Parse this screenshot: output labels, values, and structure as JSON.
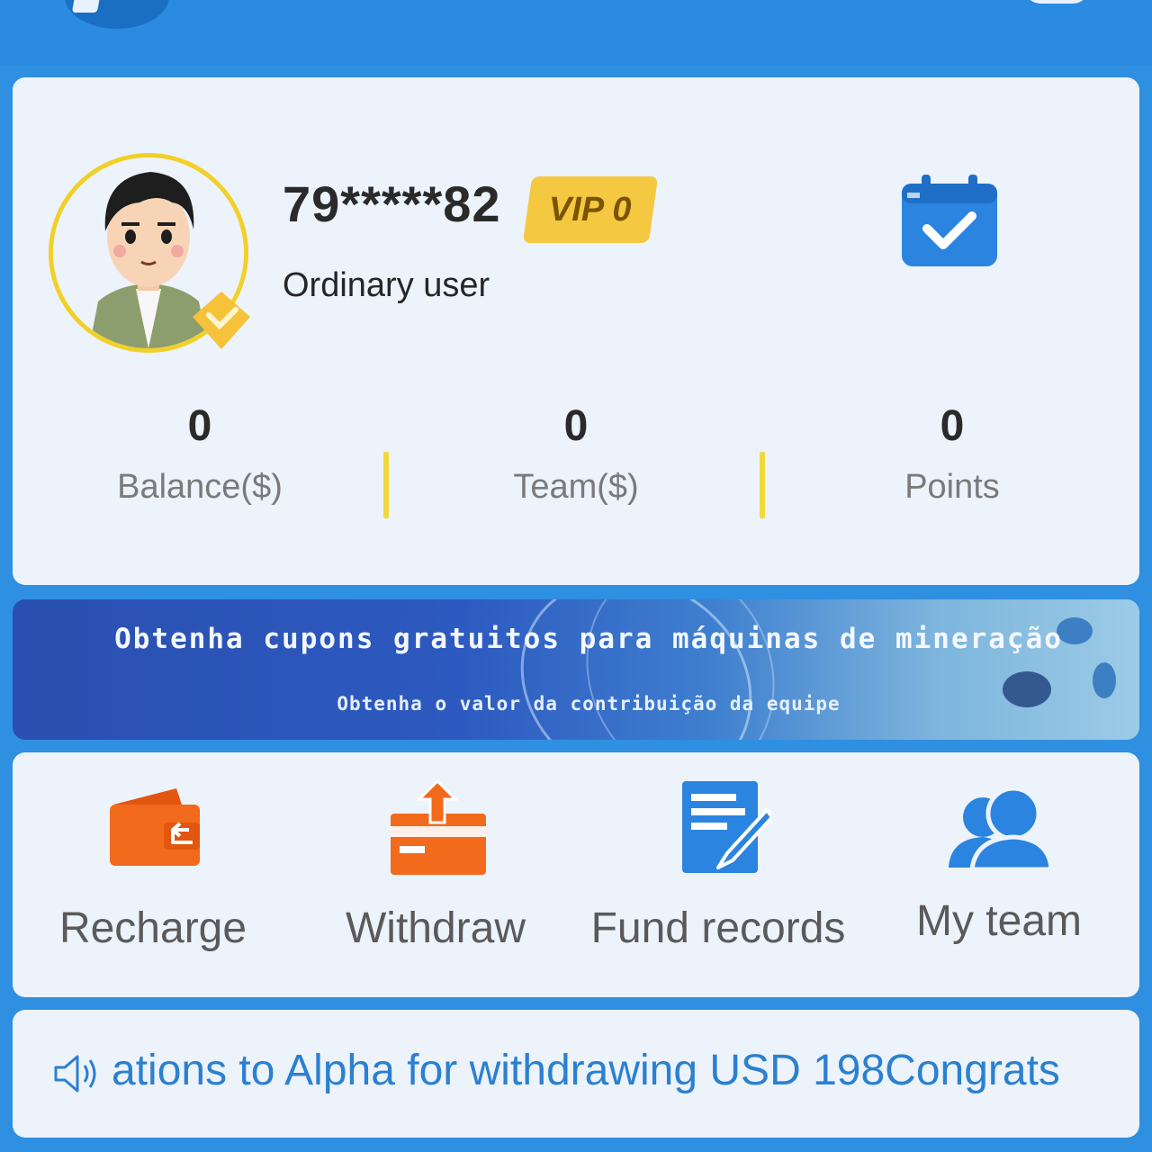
{
  "profile": {
    "username": "79*****82",
    "vip_label": "VIP 0",
    "user_type": "Ordinary user"
  },
  "stats": [
    {
      "value": "0",
      "label": "Balance($)"
    },
    {
      "value": "0",
      "label": "Team($)"
    },
    {
      "value": "0",
      "label": "Points"
    }
  ],
  "banner": {
    "title": "Obtenha cupons gratuitos para máquinas de mineração",
    "subtitle": "Obtenha o valor da contribuição da equipe"
  },
  "actions": [
    {
      "label": "Recharge",
      "icon": "wallet-icon"
    },
    {
      "label": "Withdraw",
      "icon": "withdraw-icon"
    },
    {
      "label": "Fund records",
      "icon": "document-edit-icon"
    },
    {
      "label": "My team",
      "icon": "team-icon"
    }
  ],
  "notice": {
    "text": "ations to Alpha for withdrawing USD 198Congrats",
    "icon": "speaker-icon"
  },
  "colors": {
    "background": "#2f8fe0",
    "card": "#edf3fb",
    "orange": "#f26a1b",
    "blue_icon": "#2b84df",
    "gold": "#f5c842"
  }
}
